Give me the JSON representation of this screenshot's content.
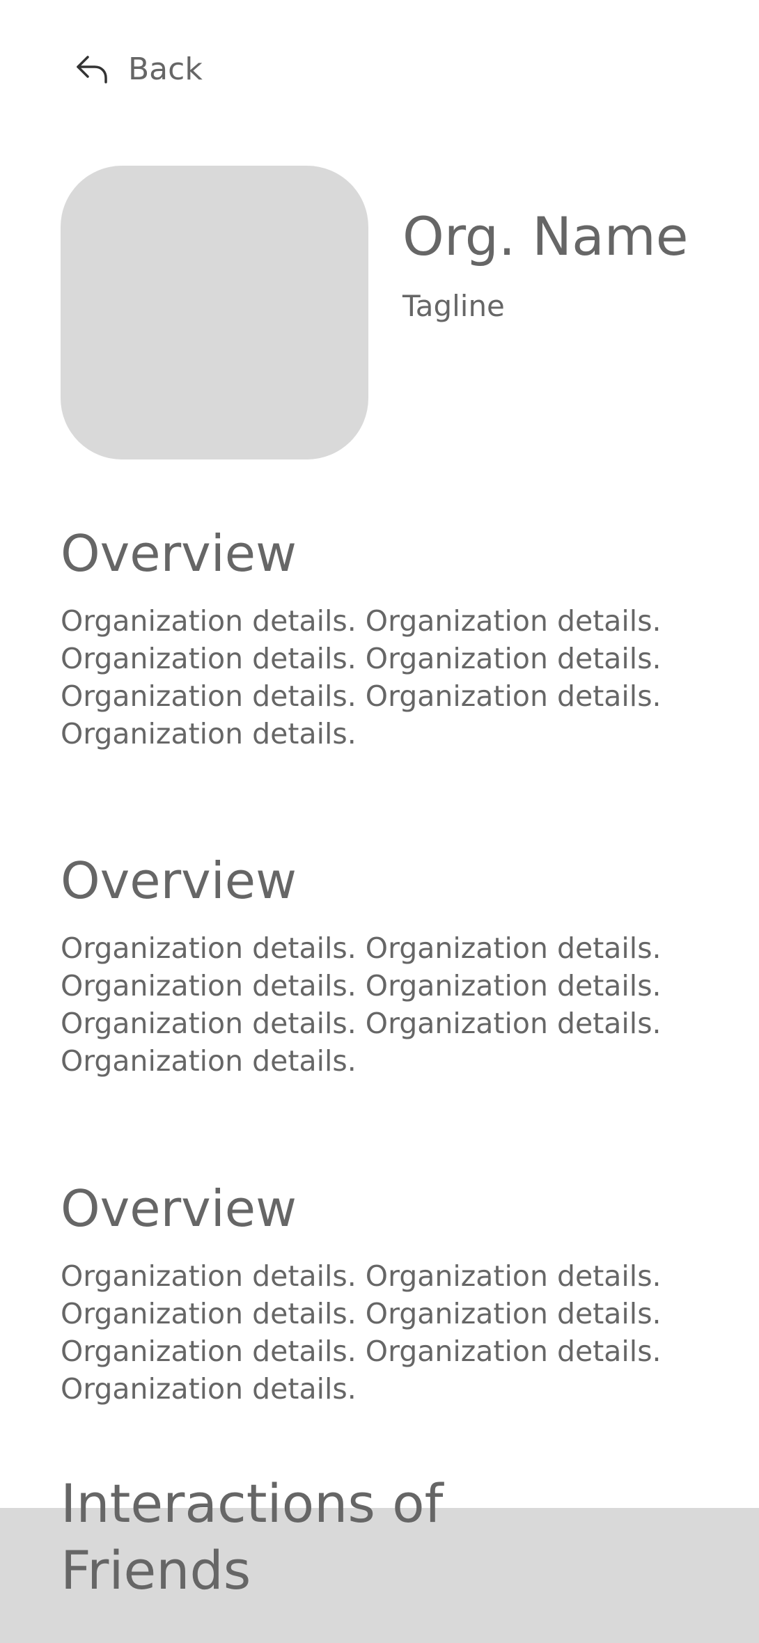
{
  "nav": {
    "back_label": "Back",
    "back_icon": "back-arrow-icon"
  },
  "header": {
    "org_name": "Org. Name",
    "tagline": "Tagline"
  },
  "sections": [
    {
      "title": "Overview",
      "lines": [
        "Organization details. Organization details.",
        "Organization details. Organization details.",
        "Organization details. Organization details.",
        "Organization details."
      ]
    },
    {
      "title": "Overview",
      "lines": [
        "Organization details. Organization details.",
        "Organization details. Organization details.",
        "Organization details. Organization details.",
        "Organization details."
      ]
    },
    {
      "title": "Overview",
      "lines": [
        "Organization details. Organization details.",
        "Organization details. Organization details.",
        "Organization details. Organization details.",
        "Organization details."
      ]
    }
  ],
  "friends": {
    "title": "Interactions of Friends"
  },
  "colors": {
    "text": "#666666",
    "placeholder": "#d9d9d9",
    "background": "#ffffff"
  }
}
